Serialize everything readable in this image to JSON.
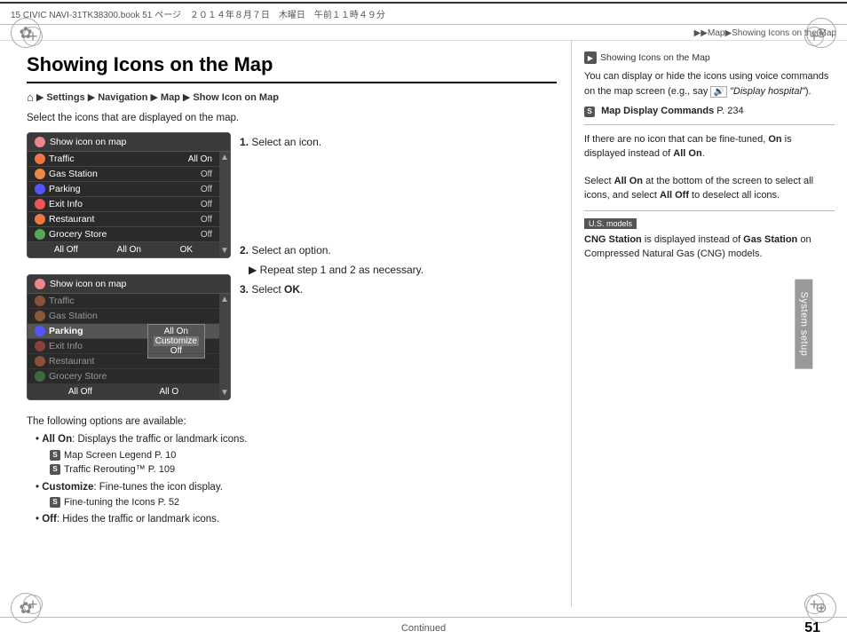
{
  "topbar": {
    "left": "15 CIVIC NAVI-31TK38300.book  51 ページ　２０１４年８月７日　木曜日　午前１１時４９分",
    "right": ""
  },
  "breadcrumb_top": "▶▶Map▶Showing Icons on the Map",
  "page_title": "Showing Icons on the Map",
  "nav_breadcrumb": {
    "home_icon": "⌂",
    "items": [
      "HOME",
      "Settings",
      "Navigation",
      "Map",
      "Show Icon on Map"
    ],
    "separators": [
      "▶",
      "▶",
      "▶",
      "▶"
    ]
  },
  "intro_text": "Select the icons that are displayed on the map.",
  "screenshot1": {
    "header": "Show icon on map",
    "rows": [
      {
        "icon_color": "#e74",
        "label": "Traffic",
        "value": "All On",
        "selected": false
      },
      {
        "icon_color": "#e84",
        "label": "Gas Station",
        "value": "Off",
        "selected": false
      },
      {
        "icon_color": "#55f",
        "label": "Parking",
        "value": "Off",
        "selected": false
      },
      {
        "icon_color": "#e55",
        "label": "Exit Info",
        "value": "Off",
        "selected": false
      },
      {
        "icon_color": "#e74",
        "label": "Restaurant",
        "value": "Off",
        "selected": false
      },
      {
        "icon_color": "#5a5",
        "label": "Grocery Store",
        "value": "Off",
        "selected": false
      }
    ],
    "footer": [
      "All Off",
      "All On",
      "OK"
    ]
  },
  "screenshot2": {
    "header": "Show icon on map",
    "rows": [
      {
        "icon_color": "#e74",
        "label": "Traffic",
        "value": "",
        "selected": false,
        "dimmed": true
      },
      {
        "icon_color": "#e84",
        "label": "Gas Station",
        "value": "",
        "selected": false,
        "dimmed": true
      },
      {
        "icon_color": "#55f",
        "label": "Parking",
        "value": "",
        "selected": true,
        "dimmed": false
      },
      {
        "icon_color": "#e55",
        "label": "Exit Info",
        "value": "",
        "selected": false,
        "dimmed": true
      },
      {
        "icon_color": "#e74",
        "label": "Restaurant",
        "value": "",
        "selected": false,
        "dimmed": true
      },
      {
        "icon_color": "#5a5",
        "label": "Grocery Store",
        "value": "",
        "selected": false,
        "dimmed": true
      }
    ],
    "overlay": {
      "options": [
        "All On",
        "Customize",
        "Off"
      ]
    },
    "footer": [
      "All Off",
      "All O"
    ]
  },
  "steps": [
    {
      "num": "1.",
      "text": "Select an icon."
    },
    {
      "num": "2.",
      "text": "Select an option."
    },
    {
      "sub": "▶ Repeat step 1 and 2 as necessary."
    },
    {
      "num": "3.",
      "text": "Select OK."
    }
  ],
  "options_section": {
    "intro": "The following options are available:",
    "items": [
      {
        "bullet": "•",
        "label": "All On",
        "desc": ": Displays the traffic or landmark icons.",
        "refs": [
          {
            "icon": "S",
            "text": "Map Screen Legend P. 10"
          },
          {
            "icon": "S",
            "text": "Traffic Rerouting™ P. 109"
          }
        ]
      },
      {
        "bullet": "•",
        "label": "Customize",
        "desc": ": Fine-tunes the icon display.",
        "refs": [
          {
            "icon": "S",
            "text": "Fine-tuning the Icons P. 52"
          }
        ]
      },
      {
        "bullet": "•",
        "label": "Off",
        "desc": ": Hides the traffic or landmark icons.",
        "refs": []
      }
    ]
  },
  "right_panel": {
    "note_header": "Showing Icons on the Map",
    "note_text1": "You can display or hide the icons using voice commands on the map screen (e.g., say ",
    "note_text_italic": "\"Display hospital\"",
    "note_text2": ").",
    "map_display": "Map Display Commands P. 234",
    "fine_tune_text": "If there are no icon that can be fine-tuned, On is displayed instead of ",
    "fine_tune_bold": "All On",
    "fine_tune_text2": ".",
    "select_all_text": "Select All On at the bottom of the screen to select all icons, and select All Off to deselect all icons.",
    "us_models_badge": "U.S. models",
    "us_models_text": "CNG Station is displayed instead of Gas Station on Compressed Natural Gas (CNG) models."
  },
  "system_setup_tab": "System setup",
  "bottom": {
    "continued": "Continued",
    "page_number": "51"
  },
  "corners": {
    "tl": "+",
    "tr": "+",
    "bl": "+",
    "br": "+"
  }
}
